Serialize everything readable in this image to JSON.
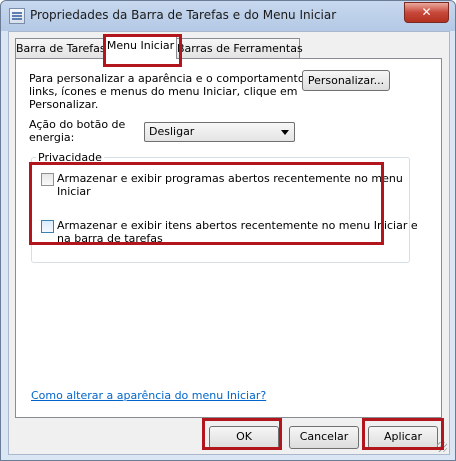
{
  "window": {
    "title": "Propriedades da Barra de Tarefas e do Menu Iniciar",
    "close_label": "✕"
  },
  "tabs": [
    {
      "label": "Barra de Tarefas",
      "active": false
    },
    {
      "label": "Menu Iniciar",
      "active": true
    },
    {
      "label": "Barras de Ferramentas",
      "active": false
    }
  ],
  "customize": {
    "description_lines": [
      "Para personalizar a aparência e o comportamento dos",
      "links, ícones e menus do menu Iniciar, clique em",
      "Personalizar."
    ],
    "button_label": "Personalizar..."
  },
  "power": {
    "label_lines": [
      "Ação do botão de",
      "energia:"
    ],
    "selected": "Desligar"
  },
  "privacy": {
    "group_label": "Privacidade",
    "options": [
      {
        "lines": [
          "Armazenar e exibir programas abertos recentemente no menu",
          "Iniciar"
        ],
        "checked": false
      },
      {
        "lines": [
          "Armazenar e exibir itens abertos recentemente no menu Iniciar e",
          "na barra de tarefas"
        ],
        "checked": false
      }
    ]
  },
  "help_link": "Como alterar a aparência do menu Iniciar?",
  "buttons": {
    "ok": "OK",
    "cancel": "Cancelar",
    "apply": "Aplicar"
  },
  "colors": {
    "highlight_box": "#b3151d",
    "link": "#0066cc"
  }
}
